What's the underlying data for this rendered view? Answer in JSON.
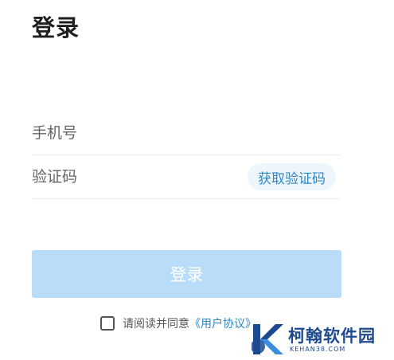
{
  "page": {
    "title": "登录"
  },
  "form": {
    "phone_placeholder": "手机号",
    "code_placeholder": "验证码",
    "get_code_label": "获取验证码",
    "login_label": "登录"
  },
  "agreement": {
    "prefix": "请阅读并同意",
    "link_text": "《用户协议》"
  },
  "watermark": {
    "name": "柯翰软件园",
    "domain": "KEHAN38.COM"
  },
  "colors": {
    "accent": "#2c88c6",
    "button_disabled": "#b9dcf8",
    "code_button_bg": "#eef6fc",
    "watermark": "#1d4a8f"
  }
}
